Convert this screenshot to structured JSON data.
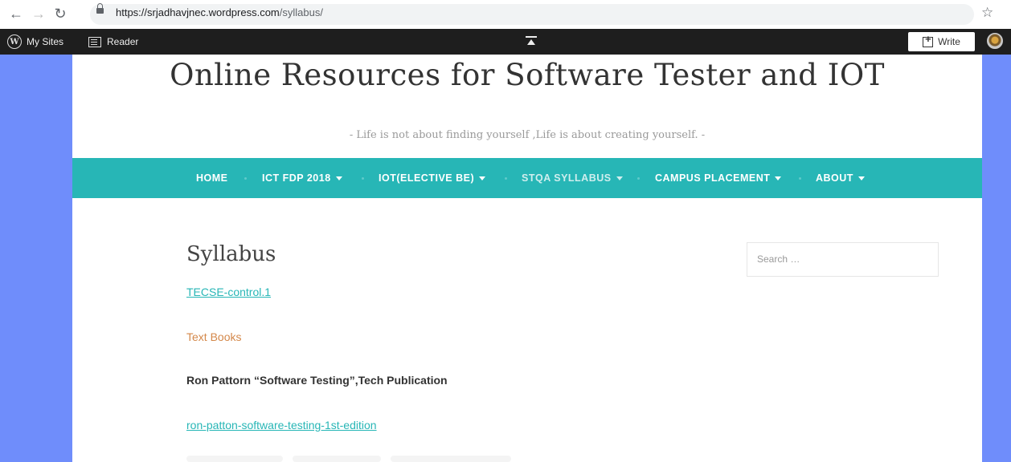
{
  "browser": {
    "url_host": "https://srjadhavjnec.wordpress.com",
    "url_path": "/syllabus/"
  },
  "adminbar": {
    "my_sites": "My Sites",
    "reader": "Reader",
    "write": "Write"
  },
  "site": {
    "title": "Online Resources for Software Tester and IOT",
    "tagline": "- Life is not about finding yourself ,Life is about creating yourself. -"
  },
  "menu": {
    "items": [
      {
        "label": "HOME"
      },
      {
        "label": "ICT FDP 2018"
      },
      {
        "label": "IOT(ELECTIVE BE)"
      },
      {
        "label": "STQA SYLLABUS"
      },
      {
        "label": "CAMPUS PLACEMENT"
      },
      {
        "label": "ABOUT"
      }
    ]
  },
  "content": {
    "title": "Syllabus",
    "link1": "TECSE-control.1",
    "text_books": "Text Books",
    "book": "Ron Pattorn “Software Testing”,Tech Publication",
    "link2": "ron-patton-software-testing-1st-edition"
  },
  "search": {
    "placeholder": "Search …"
  }
}
